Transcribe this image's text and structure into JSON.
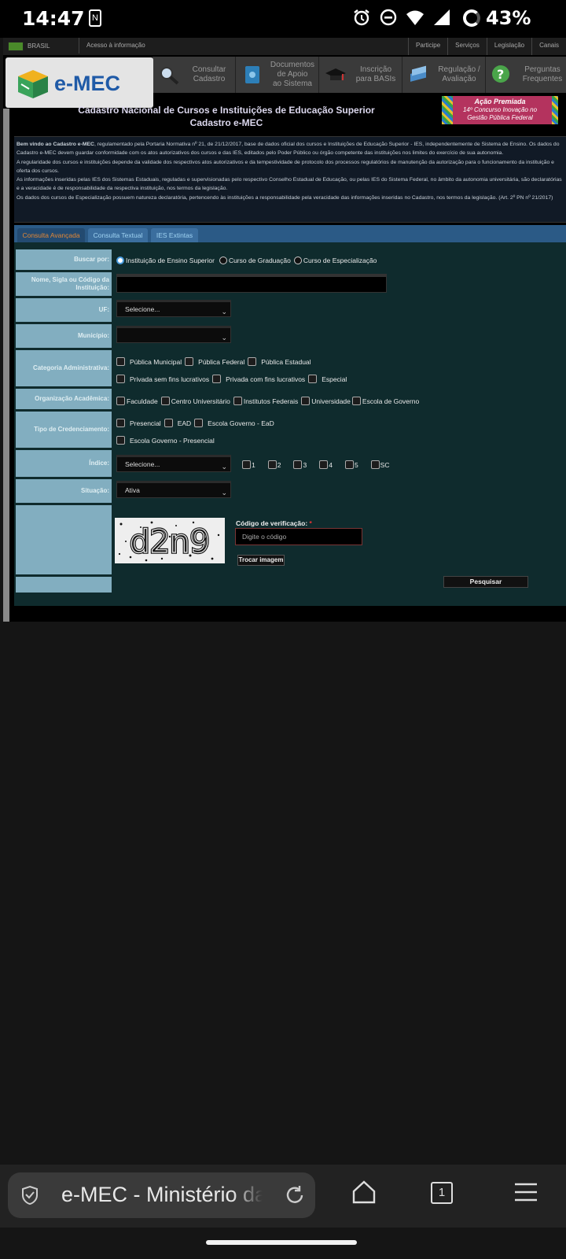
{
  "status_bar": {
    "time": "14:47",
    "battery": "43%"
  },
  "gov_bar": {
    "brasil": "BRASIL",
    "acesso": "Acesso à informação",
    "links": [
      "Participe",
      "Serviços",
      "Legislação",
      "Canais"
    ]
  },
  "logo_text": "e-MEC",
  "menu": [
    {
      "label1": "Consultar",
      "label2": "Cadastro",
      "label3": ""
    },
    {
      "label1": "Documentos",
      "label2": "de Apoio",
      "label3": "ao Sistema"
    },
    {
      "label1": "Inscrição",
      "label2": "para BASIs",
      "label3": ""
    },
    {
      "label1": "Regulação /",
      "label2": "Avaliação",
      "label3": ""
    },
    {
      "label1": "Perguntas",
      "label2": "Frequentes",
      "label3": ""
    }
  ],
  "award": {
    "line1": "Ação Premiada",
    "line2": "14º Concurso Inovação no",
    "line3": "Gestão Pública Federal"
  },
  "title": {
    "line1": "Cadastro Nacional de Cursos e Instituições de Educação Superior",
    "line2": "Cadastro e-MEC"
  },
  "intro": {
    "bold": "Bem vindo ao Cadastro e-MEC",
    "p1": ", regulamentado pela Portaria Normativa nº 21, de 21/12/2017, base de dados oficial dos cursos e Instituições de Educação Superior - IES, independentemente de Sistema de Ensino. Os dados do Cadastro e-MEC devem guardar conformidade com os atos autorizativos dos cursos e das IES, editados pelo Poder Público ou órgão competente das instituições nos limites do exercício de sua autonomia.",
    "p2": "A regularidade dos cursos e instituições depende da validade dos respectivos atos autorizativos e da tempestividade de protocolo dos processos regulatórios de manutenção da autorização para o funcionamento da instituição e oferta dos cursos.",
    "p3": "As informações inseridas pelas IES dos Sistemas Estaduais, reguladas e supervisionadas pelo respectivo Conselho Estadual de Educação, ou pelas IES do Sistema Federal, no âmbito da autonomia universitária, são declaratórias e a veracidade é de responsabilidade da respectiva instituição, nos termos da legislação.",
    "p4": "Os dados dos cursos de Especialização possuem natureza declaratória, pertencendo às instituições a responsabilidade pela veracidade das informações inseridas no Cadastro, nos termos da legislação. (Art. 2º PN nº 21/2017)"
  },
  "tabs": [
    "Consulta Avançada",
    "Consulta Textual",
    "IES Extintas"
  ],
  "form": {
    "buscar_label": "Buscar por:",
    "buscar_options": [
      "Instituição de Ensino Superior",
      "Curso de Graduação",
      "Curso de Especialização"
    ],
    "nome_label": "Nome, Sigla ou Código da Instituição:",
    "uf_label": "UF:",
    "uf_value": "Selecione...",
    "municipio_label": "Município:",
    "municipio_value": "",
    "categoria_label": "Categoria Administrativa:",
    "categoria_options": [
      "Pública Municipal",
      "Pública Federal",
      "Pública Estadual",
      "Privada sem fins lucrativos",
      "Privada com fins lucrativos",
      "Especial"
    ],
    "org_label": "Organização Acadêmica:",
    "org_options": [
      "Faculdade",
      "Centro Universitário",
      "Institutos Federais",
      "Universidade",
      "Escola de Governo"
    ],
    "tipo_label": "Tipo de Credenciamento:",
    "tipo_options": [
      "Presencial",
      "EAD",
      "Escola Governo - EaD",
      "Escola Governo - Presencial"
    ],
    "indice_label": "Índice:",
    "indice_value": "Selecione...",
    "indice_options": [
      "1",
      "2",
      "3",
      "4",
      "5",
      "SC"
    ],
    "situacao_label": "Situação:",
    "situacao_value": "Ativa",
    "captcha_text": "d2n9",
    "codigo_label": "Código de verificação:",
    "codigo_required": "*",
    "codigo_placeholder": "Digite o código",
    "trocar_label": "Trocar imagem",
    "pesquisar_label": "Pesquisar"
  },
  "browser": {
    "url": "e-MEC - Ministério da Educação",
    "tab_count": "1"
  }
}
